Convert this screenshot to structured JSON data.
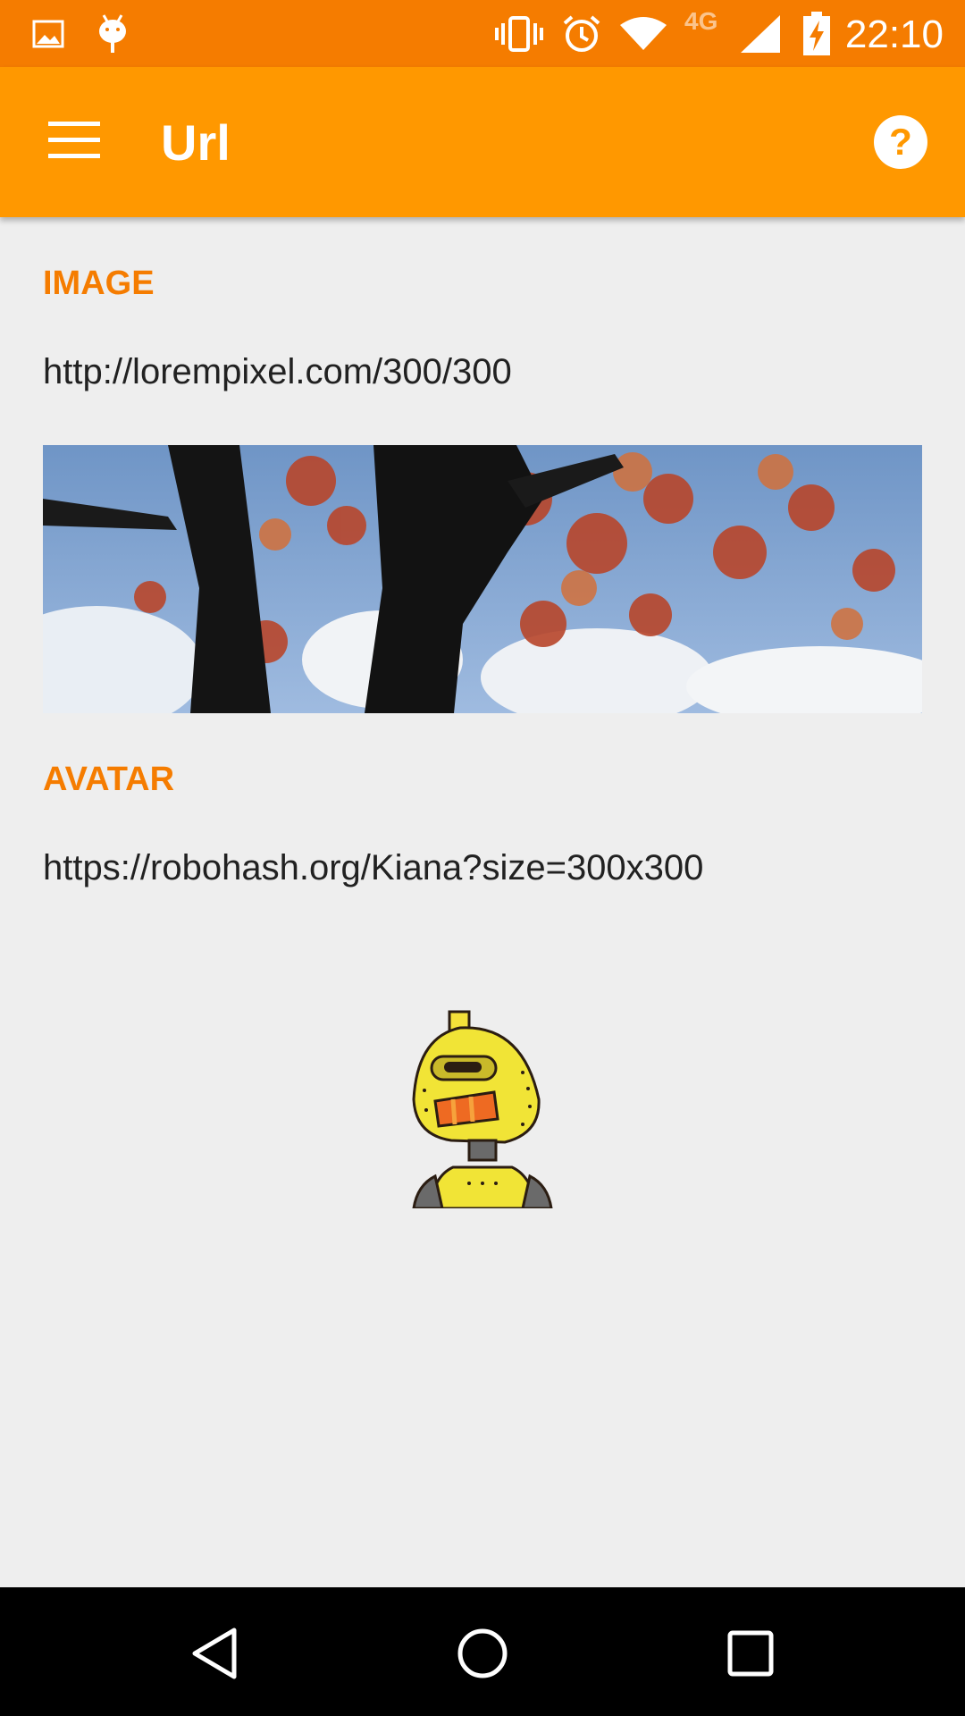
{
  "status_bar": {
    "time": "22:10",
    "network_type": "4G",
    "icons": [
      "image-notification-icon",
      "android-debug-icon",
      "vibrate-icon",
      "alarm-icon",
      "wifi-icon",
      "signal-icon",
      "battery-charging-icon"
    ],
    "background_color": "#f57c00"
  },
  "app_bar": {
    "title": "Url",
    "menu_icon": "menu-icon",
    "help_icon": "help-icon",
    "background_color": "#ff9800"
  },
  "image_section": {
    "label": "IMAGE",
    "url": "http://lorempixel.com/300/300"
  },
  "avatar_section": {
    "label": "AVATAR",
    "url": "https://robohash.org/Kiana?size=300x300"
  },
  "accent_color": "#f57c00",
  "nav_bar": {
    "back_icon": "back-icon",
    "home_icon": "home-icon",
    "recents_icon": "recents-icon"
  }
}
